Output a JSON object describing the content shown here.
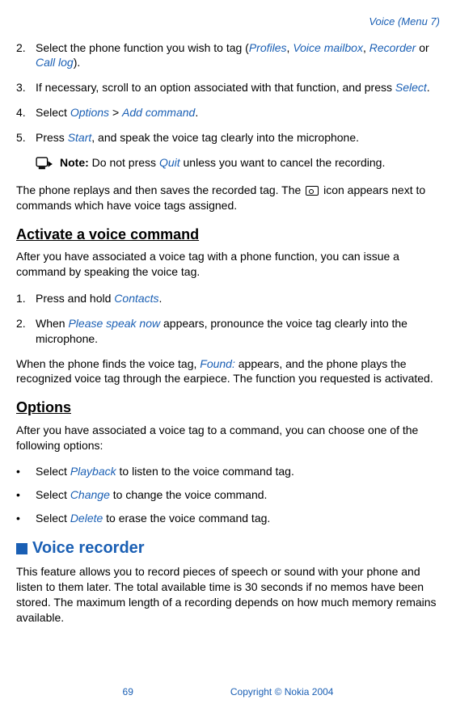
{
  "header": {
    "title": "Voice (Menu 7)"
  },
  "steps_a": [
    {
      "num": "2.",
      "parts": [
        {
          "t": "Select the phone function you wish to tag ("
        },
        {
          "t": "Profiles",
          "link": true
        },
        {
          "t": ", "
        },
        {
          "t": "Voice mailbox",
          "link": true
        },
        {
          "t": ", "
        },
        {
          "t": "Recorder",
          "link": true
        },
        {
          "t": " or "
        },
        {
          "t": "Call log",
          "link": true
        },
        {
          "t": ")."
        }
      ]
    },
    {
      "num": "3.",
      "parts": [
        {
          "t": "If necessary, scroll to an option associated with that function, and press "
        },
        {
          "t": "Select",
          "link": true
        },
        {
          "t": "."
        }
      ]
    },
    {
      "num": "4.",
      "parts": [
        {
          "t": "Select "
        },
        {
          "t": "Options",
          "link": true
        },
        {
          "t": " > "
        },
        {
          "t": "Add command",
          "link": true
        },
        {
          "t": "."
        }
      ]
    },
    {
      "num": "5.",
      "parts": [
        {
          "t": "Press "
        },
        {
          "t": "Start",
          "link": true
        },
        {
          "t": ", and speak the voice tag clearly into the microphone."
        }
      ]
    }
  ],
  "note": {
    "label": "Note:",
    "parts": [
      {
        "t": " Do not press "
      },
      {
        "t": "Quit",
        "link": true
      },
      {
        "t": " unless you want to cancel the recording."
      }
    ]
  },
  "replay": {
    "pre": "The phone replays and then saves the recorded tag. The ",
    "post": " icon appears next to commands which have voice tags assigned."
  },
  "section_activate": {
    "title": "Activate a voice command",
    "intro": "After you have associated a voice tag with a phone function, you can issue a command by speaking the voice tag.",
    "steps": [
      {
        "num": "1.",
        "parts": [
          {
            "t": "Press and hold "
          },
          {
            "t": "Contacts",
            "link": true
          },
          {
            "t": "."
          }
        ]
      },
      {
        "num": "2.",
        "parts": [
          {
            "t": "When "
          },
          {
            "t": "Please speak now",
            "link": true
          },
          {
            "t": " appears, pronounce the voice tag clearly into the microphone."
          }
        ]
      }
    ],
    "found_parts": [
      {
        "t": "When the phone finds the voice tag, "
      },
      {
        "t": "Found:",
        "link": true
      },
      {
        "t": " appears, and the phone plays the recognized voice tag through the earpiece. The function you requested is activated."
      }
    ]
  },
  "section_options": {
    "title": "Options",
    "intro": "After you have associated a voice tag to a command, you can choose one of the following options:",
    "bullets": [
      [
        {
          "t": "Select "
        },
        {
          "t": "Playback",
          "link": true
        },
        {
          "t": " to listen to the voice command tag."
        }
      ],
      [
        {
          "t": "Select "
        },
        {
          "t": "Change",
          "link": true
        },
        {
          "t": " to change the voice command."
        }
      ],
      [
        {
          "t": "Select "
        },
        {
          "t": "Delete",
          "link": true
        },
        {
          "t": " to erase the voice command tag."
        }
      ]
    ]
  },
  "section_recorder": {
    "title": "Voice recorder",
    "body": "This feature allows you to record pieces of speech or sound with your phone and listen to them later. The total available time is 30 seconds if no memos have been stored. The maximum length of a recording depends on how much memory remains available."
  },
  "footer": {
    "page": "69",
    "copyright": "Copyright © Nokia 2004"
  }
}
